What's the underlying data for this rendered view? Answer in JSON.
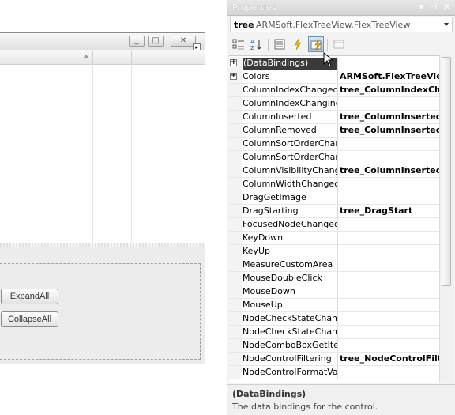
{
  "designer": {
    "buttons": {
      "expand_all": "ExpandAll",
      "collapse_all": "CollapseAll"
    },
    "window_buttons": {
      "minimize": "_",
      "maximize": "□",
      "close": "✕"
    }
  },
  "properties": {
    "title": "Properties",
    "title_buttons": "▾ ⊣ ✕",
    "object_name": "tree",
    "object_type": "ARMSoft.FlexTreeView.FlexTreeView",
    "toolbar": {
      "categorized": "categorized-icon",
      "alphabetical": "alphabetical-icon",
      "properties": "properties-icon",
      "events": "events-icon",
      "property_pages": "property-pages-icon"
    },
    "rows": [
      {
        "name": "(DataBindings)",
        "value": "",
        "expandable": true,
        "selected": true
      },
      {
        "name": "Colors",
        "value": "ARMSoft.FlexTreeView",
        "expandable": true,
        "selected": false
      },
      {
        "name": "ColumnIndexChanged",
        "value": "tree_ColumnIndexCha",
        "expandable": false,
        "selected": false
      },
      {
        "name": "ColumnIndexChanging",
        "value": "",
        "expandable": false,
        "selected": false
      },
      {
        "name": "ColumnInserted",
        "value": "tree_ColumnInserted",
        "expandable": false,
        "selected": false
      },
      {
        "name": "ColumnRemoved",
        "value": "tree_ColumnInserted",
        "expandable": false,
        "selected": false
      },
      {
        "name": "ColumnSortOrderChange",
        "value": "",
        "expandable": false,
        "selected": false
      },
      {
        "name": "ColumnSortOrderChangin",
        "value": "",
        "expandable": false,
        "selected": false
      },
      {
        "name": "ColumnVisibilityChanged",
        "value": "tree_ColumnInserted",
        "expandable": false,
        "selected": false
      },
      {
        "name": "ColumnWidthChanged",
        "value": "",
        "expandable": false,
        "selected": false
      },
      {
        "name": "DragGetImage",
        "value": "",
        "expandable": false,
        "selected": false
      },
      {
        "name": "DragStarting",
        "value": "tree_DragStart",
        "expandable": false,
        "selected": false
      },
      {
        "name": "FocusedNodeChanged",
        "value": "",
        "expandable": false,
        "selected": false
      },
      {
        "name": "KeyDown",
        "value": "",
        "expandable": false,
        "selected": false
      },
      {
        "name": "KeyUp",
        "value": "",
        "expandable": false,
        "selected": false
      },
      {
        "name": "MeasureCustomArea",
        "value": "",
        "expandable": false,
        "selected": false
      },
      {
        "name": "MouseDoubleClick",
        "value": "",
        "expandable": false,
        "selected": false
      },
      {
        "name": "MouseDown",
        "value": "",
        "expandable": false,
        "selected": false
      },
      {
        "name": "MouseUp",
        "value": "",
        "expandable": false,
        "selected": false
      },
      {
        "name": "NodeCheckStateChange",
        "value": "",
        "expandable": false,
        "selected": false
      },
      {
        "name": "NodeCheckStateChangin",
        "value": "",
        "expandable": false,
        "selected": false
      },
      {
        "name": "NodeComboBoxGetItems",
        "value": "",
        "expandable": false,
        "selected": false
      },
      {
        "name": "NodeControlFiltering",
        "value": "tree_NodeControlFilter",
        "expandable": false,
        "selected": false
      },
      {
        "name": "NodeControlFormatValue",
        "value": "",
        "expandable": false,
        "selected": false
      }
    ],
    "description": {
      "title": "(DataBindings)",
      "text": "The data bindings for the control."
    }
  },
  "colors": {
    "selected_row": "#3a3a3a",
    "toolbar_active": "#aac6e2"
  }
}
